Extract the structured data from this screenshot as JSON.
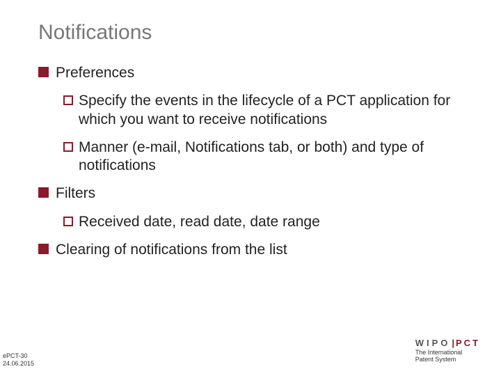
{
  "title": "Notifications",
  "items": {
    "preferences": {
      "label": "Preferences",
      "sub1": "Specify the events in the lifecycle of a PCT application for which you want to receive notifications",
      "sub2": "Manner (e-mail, Notifications tab, or both) and type of notifications"
    },
    "filters": {
      "label": "Filters",
      "sub1": "Received date, read date, date range"
    },
    "clearing": {
      "label": "Clearing of notifications from the list"
    }
  },
  "footer": {
    "code": "ePCT-30",
    "date": "24.06.2015",
    "brand1": "WIPO",
    "brand2": "PCT",
    "tag1": "The International",
    "tag2": "Patent System"
  }
}
